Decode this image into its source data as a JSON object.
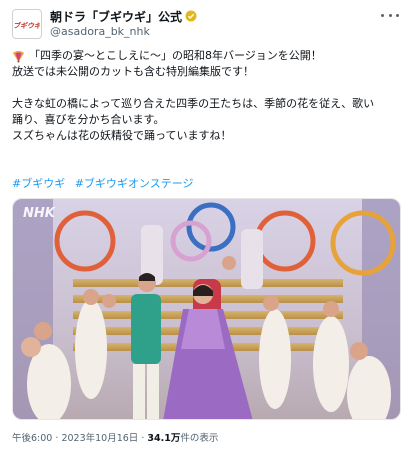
{
  "account": {
    "display_name": "朝ドラ「ブギウギ」公式",
    "handle": "@asadora_bk_nhk",
    "avatar_text": "ブギウギ"
  },
  "post": {
    "lines": [
      "「四季の宴〜とこしえに〜」の昭和8年バージョンを公開！",
      "放送では未公開のカットも含む特別編集版です！",
      "大きな虹の橋によって巡り合えた四季の王たちは、季節の花を従え、歌い",
      "踊り、喜びを分かち合います。",
      "スズちゃんは花の妖精役で踊っていますね！"
    ],
    "hashtags": [
      "#ブギウギ",
      "#ブギウギオンステージ"
    ]
  },
  "media": {
    "watermark": "NHK"
  },
  "footer": {
    "time": "午後6:00",
    "date": "2023年10月16日",
    "views_count": "34.1万",
    "views_label": "件の表示",
    "separator": "·"
  },
  "colors": {
    "link": "#1d9bf0",
    "verified_badge": "#e2b719",
    "secondary_text": "#536471"
  }
}
